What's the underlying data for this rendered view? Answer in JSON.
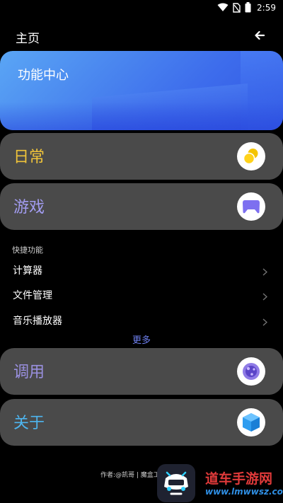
{
  "status_bar": {
    "time": "2:59",
    "icons": [
      "wifi-icon",
      "no-sim-icon",
      "battery-icon"
    ]
  },
  "header": {
    "title": "主页",
    "back_icon": "arrow-left-icon"
  },
  "banner": {
    "title": "功能中心"
  },
  "cards": [
    {
      "label": "日常",
      "color": "#f0c43a",
      "icon": "coins-icon"
    },
    {
      "label": "游戏",
      "color": "#a29cf0",
      "icon": "gamepad-icon"
    },
    {
      "label": "调用",
      "color": "#9a90e0",
      "icon": "purple-orb-icon"
    },
    {
      "label": "关于",
      "color": "#4eb5ef",
      "icon": "blue-cube-icon"
    }
  ],
  "quick": {
    "section_label": "快捷功能",
    "items": [
      {
        "label": "计算器"
      },
      {
        "label": "文件管理"
      },
      {
        "label": "音乐播放器"
      }
    ],
    "more_label": "更多"
  },
  "footer": {
    "text": "作者:@凯哥 | 魔盒工",
    "watermark_title": "道车手游网",
    "watermark_url": "www.lmwwsz.com"
  },
  "colors": {
    "background": "#000000",
    "card": "#4a4a4a",
    "accent_more": "#6f80f0",
    "banner": "#4a86ef"
  }
}
